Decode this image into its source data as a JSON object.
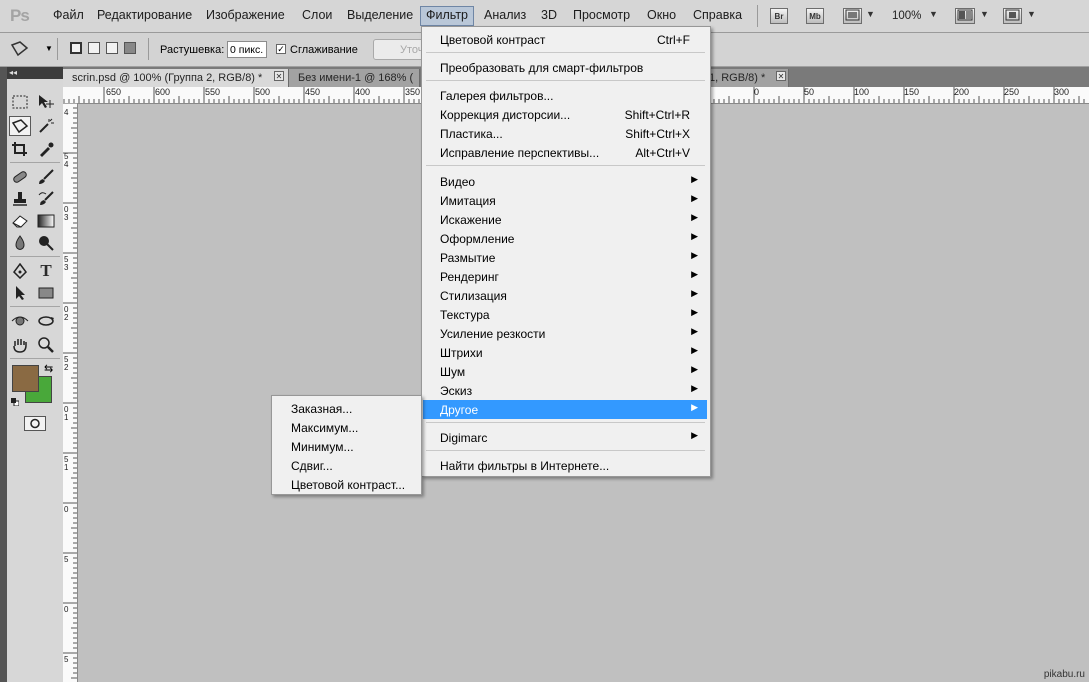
{
  "menubar": {
    "logo": "Ps",
    "items": [
      "Файл",
      "Редактирование",
      "Изображение",
      "Слои",
      "Выделение",
      "Фильтр",
      "Анализ",
      "3D",
      "Просмотр",
      "Окно",
      "Справка"
    ],
    "active_item": "Фильтр",
    "bridge_icon": "Br",
    "minibridge_icon": "Mb",
    "zoom": "100%"
  },
  "options": {
    "feather_label": "Растушевка:",
    "feather_value": "0 пикс.",
    "antialias_label": "Сглаживание",
    "antialias_checked": true,
    "refine_label": "Уточ"
  },
  "tabs": [
    {
      "label": "scrin.psd @ 100% (Группа 2, RGB/8) *",
      "active": true
    },
    {
      "label": "Без имени-1 @ 168% (",
      "active": false
    },
    {
      "label": "1, RGB/8) *",
      "active": false
    }
  ],
  "ruler": {
    "top_labels": [
      "650",
      "600",
      "550",
      "500",
      "450",
      "400",
      "350",
      "0",
      "50",
      "100",
      "150",
      "200",
      "250",
      "300"
    ],
    "left_labels": [
      "4",
      "5",
      "4",
      "0",
      "3",
      "5",
      "3",
      "0",
      "2",
      "5",
      "2",
      "0",
      "1",
      "5",
      "1",
      "0",
      "5",
      "0",
      "5"
    ]
  },
  "colors": {
    "foreground": "#8a6a43",
    "background": "#49a83a",
    "highlight": "#3399ff"
  },
  "filter_menu": {
    "groups": [
      [
        {
          "label": "Цветовой контраст",
          "shortcut": "Ctrl+F"
        }
      ],
      [
        {
          "label": "Преобразовать для смарт-фильтров"
        }
      ],
      [
        {
          "label": "Галерея фильтров..."
        },
        {
          "label": "Коррекция дисторсии...",
          "shortcut": "Shift+Ctrl+R"
        },
        {
          "label": "Пластика...",
          "shortcut": "Shift+Ctrl+X"
        },
        {
          "label": "Исправление перспективы...",
          "shortcut": "Alt+Ctrl+V"
        }
      ],
      [
        {
          "label": "Видео",
          "submenu": true
        },
        {
          "label": "Имитация",
          "submenu": true
        },
        {
          "label": "Искажение",
          "submenu": true
        },
        {
          "label": "Оформление",
          "submenu": true
        },
        {
          "label": "Размытие",
          "submenu": true
        },
        {
          "label": "Рендеринг",
          "submenu": true
        },
        {
          "label": "Стилизация",
          "submenu": true
        },
        {
          "label": "Текстура",
          "submenu": true
        },
        {
          "label": "Усиление резкости",
          "submenu": true
        },
        {
          "label": "Штрихи",
          "submenu": true
        },
        {
          "label": "Шум",
          "submenu": true
        },
        {
          "label": "Эскиз",
          "submenu": true
        },
        {
          "label": "Другое",
          "submenu": true,
          "highlighted": true
        }
      ],
      [
        {
          "label": "Digimarc",
          "submenu": true
        }
      ],
      [
        {
          "label": "Найти фильтры в Интернете..."
        }
      ]
    ]
  },
  "other_submenu": {
    "items": [
      "Заказная...",
      "Максимум...",
      "Минимум...",
      "Сдвиг...",
      "Цветовой контраст..."
    ]
  },
  "watermark": "pikabu.ru"
}
